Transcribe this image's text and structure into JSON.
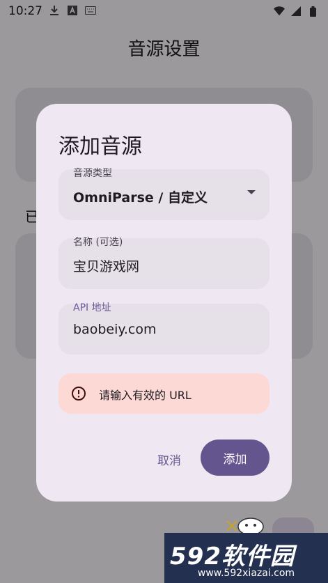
{
  "status_bar": {
    "time": "10:27",
    "left_icons": [
      "download-icon",
      "a-box-icon",
      "keyboard-icon"
    ],
    "right_icons": [
      "wifi-icon",
      "signal-icon",
      "battery-icon"
    ]
  },
  "page": {
    "title": "音源设置",
    "section_label": "已"
  },
  "dialog": {
    "title": "添加音源",
    "fields": [
      {
        "label": "音源类型",
        "value": "OmniParse / 自定义",
        "type": "dropdown"
      },
      {
        "label": "名称 (可选)",
        "value": "宝贝游戏网",
        "type": "text"
      },
      {
        "label": "API 地址",
        "value": "baobeiy.com",
        "type": "text",
        "focused": true
      }
    ],
    "error": {
      "icon": "error-circle-icon",
      "message": "请输入有效的 URL"
    },
    "buttons": {
      "cancel": "取消",
      "add": "添加"
    }
  },
  "watermark": {
    "brand": "592软件园",
    "url": "www.592xiazai.com"
  },
  "colors": {
    "primary": "#65558f",
    "dialog_bg": "#efe7f1",
    "field_bg": "#e6e0e9",
    "error_bg": "#fcd9d4"
  }
}
